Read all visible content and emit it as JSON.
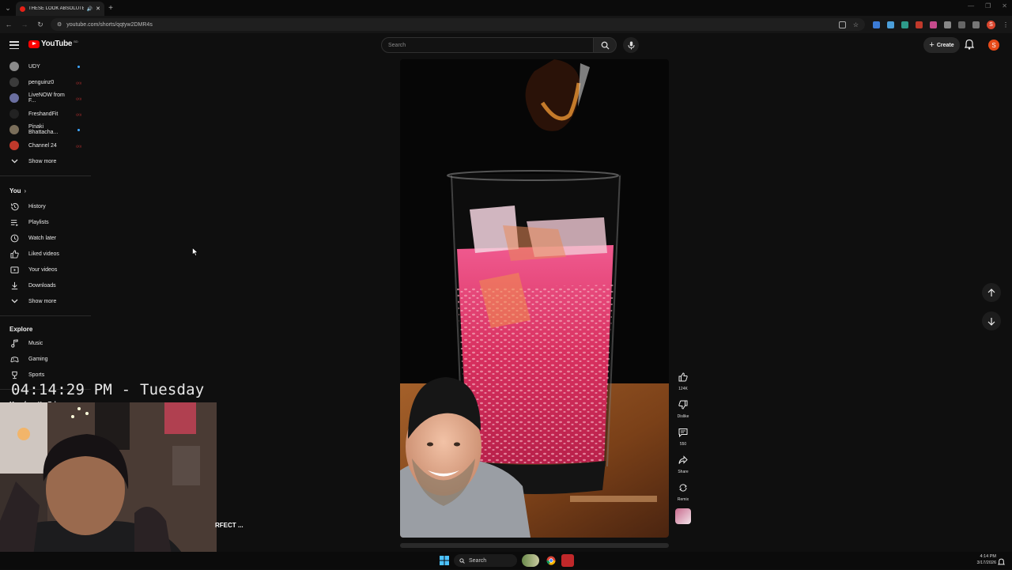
{
  "browser": {
    "tab_title": "THESE LOOK ABSOLUTELY ...",
    "url": "youtube.com/shorts/qqtyw2DMR4s"
  },
  "header": {
    "logo_text": "YouTube",
    "logo_country": "BD",
    "search_placeholder": "Search",
    "create_label": "Create",
    "avatar_letter": "S"
  },
  "sidebar": {
    "subscriptions": [
      {
        "name": "UDY",
        "status": "dot",
        "color": "#8a8a8a"
      },
      {
        "name": "penguinz0",
        "status": "live",
        "color": "#3b3b3b"
      },
      {
        "name": "LiveNOW from F...",
        "status": "live",
        "color": "#6a6fa0"
      },
      {
        "name": "FreshandFit",
        "status": "live",
        "color": "#222"
      },
      {
        "name": "Pinaki Bhattacha...",
        "status": "dot",
        "color": "#7a6e5a"
      },
      {
        "name": "Channel 24",
        "status": "live",
        "color": "#c0392b"
      }
    ],
    "show_more": "Show more",
    "you_heading": "You",
    "you_items": [
      {
        "label": "History",
        "icon": "history-icon"
      },
      {
        "label": "Playlists",
        "icon": "playlists-icon"
      },
      {
        "label": "Watch later",
        "icon": "watch-later-icon"
      },
      {
        "label": "Liked videos",
        "icon": "liked-videos-icon"
      },
      {
        "label": "Your videos",
        "icon": "your-videos-icon"
      },
      {
        "label": "Downloads",
        "icon": "downloads-icon"
      }
    ],
    "show_more_2": "Show more",
    "explore_heading": "Explore",
    "explore_items": [
      {
        "label": "Music",
        "icon": "music-icon"
      },
      {
        "label": "Gaming",
        "icon": "gaming-icon"
      },
      {
        "label": "Sports",
        "icon": "sports-icon"
      }
    ],
    "more_from": "More from YouTube"
  },
  "actions": {
    "like_count": "124K",
    "dislike_label": "Dislike",
    "comment_count": "550",
    "share_label": "Share",
    "remix_label": "Remix"
  },
  "overlay": {
    "clock": "04:14:29 PM - Tuesday",
    "caption_fragment": "RFECT ..."
  },
  "taskbar": {
    "search_label": "Search",
    "time": "4:14 PM",
    "date": "3/17/2026"
  }
}
